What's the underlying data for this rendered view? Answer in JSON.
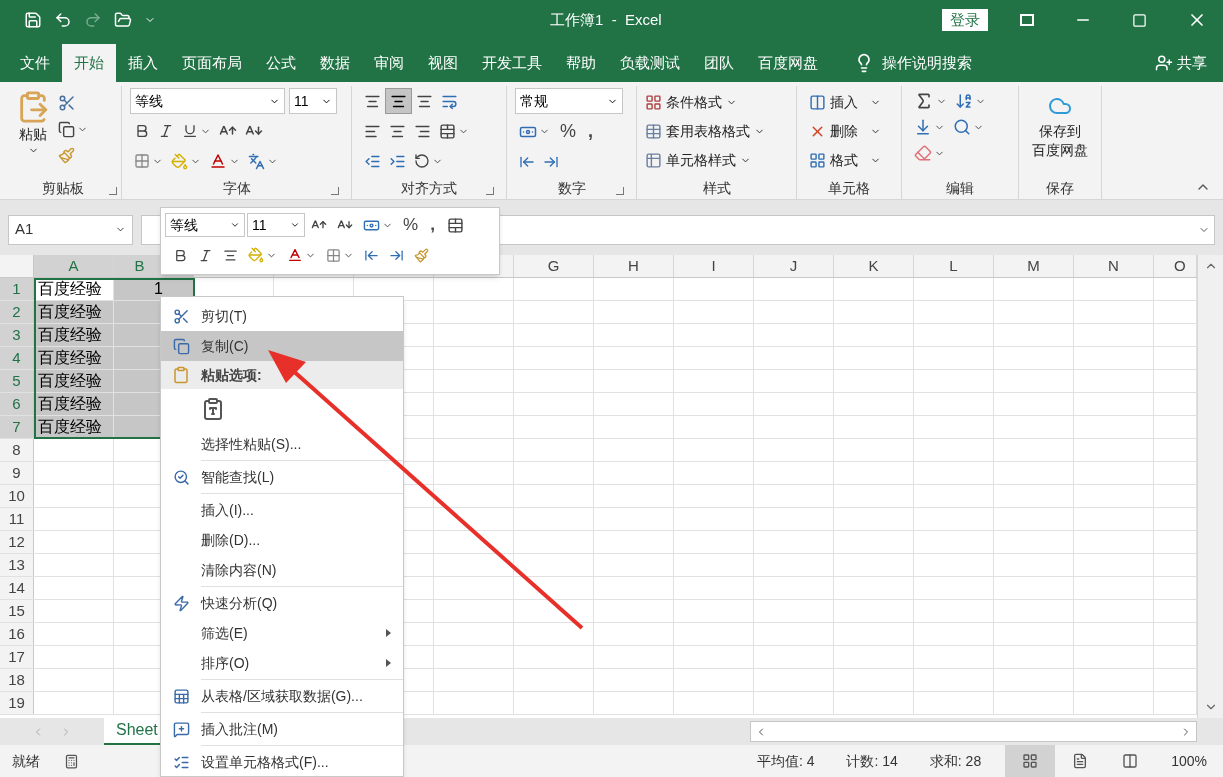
{
  "title_bar": {
    "title": "工作簿1  -  Excel",
    "sign_in": "登录"
  },
  "ribbon_tabs": [
    {
      "label": "文件",
      "selected": false
    },
    {
      "label": "开始",
      "selected": true
    },
    {
      "label": "插入",
      "selected": false
    },
    {
      "label": "页面布局",
      "selected": false
    },
    {
      "label": "公式",
      "selected": false
    },
    {
      "label": "数据",
      "selected": false
    },
    {
      "label": "审阅",
      "selected": false
    },
    {
      "label": "视图",
      "selected": false
    },
    {
      "label": "开发工具",
      "selected": false
    },
    {
      "label": "帮助",
      "selected": false
    },
    {
      "label": "负载测试",
      "selected": false
    },
    {
      "label": "团队",
      "selected": false
    },
    {
      "label": "百度网盘",
      "selected": false
    }
  ],
  "tell_me": "操作说明搜索",
  "share": "共享",
  "ribbon": {
    "clipboard": {
      "paste": "粘贴",
      "label": "剪贴板"
    },
    "font": {
      "font_name": "等线",
      "font_size": "11",
      "label": "字体"
    },
    "alignment": {
      "label": "对齐方式"
    },
    "number": {
      "format": "常规",
      "percent": "%",
      "comma": ",",
      "label": "数字"
    },
    "styles": {
      "items": [
        "条件格式",
        "套用表格格式",
        "单元格样式"
      ],
      "label": "样式"
    },
    "cells": {
      "items": [
        "插入",
        "删除",
        "格式"
      ],
      "label": "单元格"
    },
    "editing": {
      "label": "编辑"
    },
    "save": {
      "lines": [
        "保存到",
        "百度网盘"
      ],
      "label": "保存"
    }
  },
  "name_box": "A1",
  "mini_toolbar": {
    "font_name": "等线",
    "font_size": "11",
    "percent": "%",
    "comma": ","
  },
  "columns": [
    "A",
    "B",
    "G",
    "H",
    "I",
    "J",
    "K",
    "L",
    "M",
    "N",
    "O"
  ],
  "rows": [
    {
      "label": "1",
      "cells": [
        {
          "text": "百度经验",
          "selected": false
        },
        {
          "text": "1",
          "selected": true
        }
      ]
    },
    {
      "label": "2",
      "cells": [
        {
          "text": "百度经验",
          "selected": true
        },
        {
          "selected": true
        }
      ]
    },
    {
      "label": "3",
      "cells": [
        {
          "text": "百度经验",
          "selected": true
        },
        {
          "selected": true
        }
      ]
    },
    {
      "label": "4",
      "cells": [
        {
          "text": "百度经验",
          "selected": true
        },
        {
          "selected": true
        }
      ]
    },
    {
      "label": "5",
      "cells": [
        {
          "text": "百度经验",
          "selected": true
        },
        {
          "selected": true
        }
      ]
    },
    {
      "label": "6",
      "cells": [
        {
          "text": "百度经验",
          "selected": true
        },
        {
          "selected": true
        }
      ]
    },
    {
      "label": "7",
      "cells": [
        {
          "text": "百度经验",
          "selected": true
        },
        {
          "selected": true
        }
      ]
    },
    {
      "label": "8"
    },
    {
      "label": "9"
    },
    {
      "label": "10"
    },
    {
      "label": "11"
    },
    {
      "label": "12"
    },
    {
      "label": "13"
    },
    {
      "label": "14"
    },
    {
      "label": "15"
    },
    {
      "label": "16"
    },
    {
      "label": "17"
    },
    {
      "label": "18"
    },
    {
      "label": "19"
    }
  ],
  "context_menu": [
    {
      "kind": "item",
      "label": "剪切(T)",
      "selected": false
    },
    {
      "kind": "item",
      "label": "复制(C)",
      "selected": true
    },
    {
      "kind": "header",
      "label": "粘贴选项:"
    },
    {
      "kind": "paste_option"
    },
    {
      "kind": "item",
      "label": "选择性粘贴(S)...",
      "selected": false
    },
    {
      "kind": "item",
      "label": "智能查找(L)",
      "selected": false,
      "separator_before": true
    },
    {
      "kind": "item",
      "label": "插入(I)...",
      "selected": false,
      "separator_before": true
    },
    {
      "kind": "item",
      "label": "删除(D)...",
      "selected": false
    },
    {
      "kind": "item",
      "label": "清除内容(N)",
      "selected": false
    },
    {
      "kind": "item",
      "label": "快速分析(Q)",
      "selected": false,
      "separator_before": true
    },
    {
      "kind": "item",
      "label": "筛选(E)",
      "selected": false,
      "submenu": true
    },
    {
      "kind": "item",
      "label": "排序(O)",
      "selected": false,
      "submenu": true
    },
    {
      "kind": "item",
      "label": "从表格/区域获取数据(G)...",
      "selected": false,
      "separator_before": true
    },
    {
      "kind": "item",
      "label": "插入批注(M)",
      "selected": false,
      "separator_before": true
    },
    {
      "kind": "item",
      "label": "设置单元格格式(F)...",
      "selected": false,
      "separator_before": true
    }
  ],
  "sheet_tabs": [
    {
      "label": "Sheet",
      "selected": true
    }
  ],
  "status_bar": {
    "status": "就绪",
    "average": "平均值: 4",
    "count": "计数: 14",
    "sum": "求和: 28",
    "zoom": "100%",
    "views": [
      {
        "selected": true
      },
      {
        "selected": false
      },
      {
        "selected": false
      }
    ]
  }
}
